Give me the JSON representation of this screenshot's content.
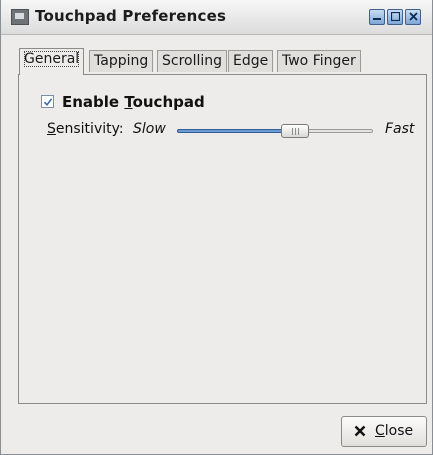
{
  "window": {
    "title": "Touchpad Preferences",
    "controls": {
      "minimize_icon": "minimize-icon",
      "maximize_icon": "maximize-icon",
      "close_icon": "close-icon"
    }
  },
  "tabs": [
    {
      "label": "General",
      "active": true
    },
    {
      "label": "Tapping",
      "active": false
    },
    {
      "label": "Scrolling",
      "active": false
    },
    {
      "label": "Edge",
      "active": false
    },
    {
      "label": "Two Finger",
      "active": false
    }
  ],
  "general": {
    "enable_touchpad": {
      "label_prefix": "Enable ",
      "label_mnemonic": "T",
      "label_rest": "ouchpad",
      "checked": true
    },
    "sensitivity": {
      "label_mnemonic": "S",
      "label_rest": "ensitivity:",
      "min_label": "Slow",
      "max_label": "Fast",
      "value": 0.62
    }
  },
  "footer": {
    "close_mnemonic": "C",
    "close_rest": "lose"
  },
  "colors": {
    "accent": "#6c9bd4",
    "accent_border": "#34609a"
  }
}
